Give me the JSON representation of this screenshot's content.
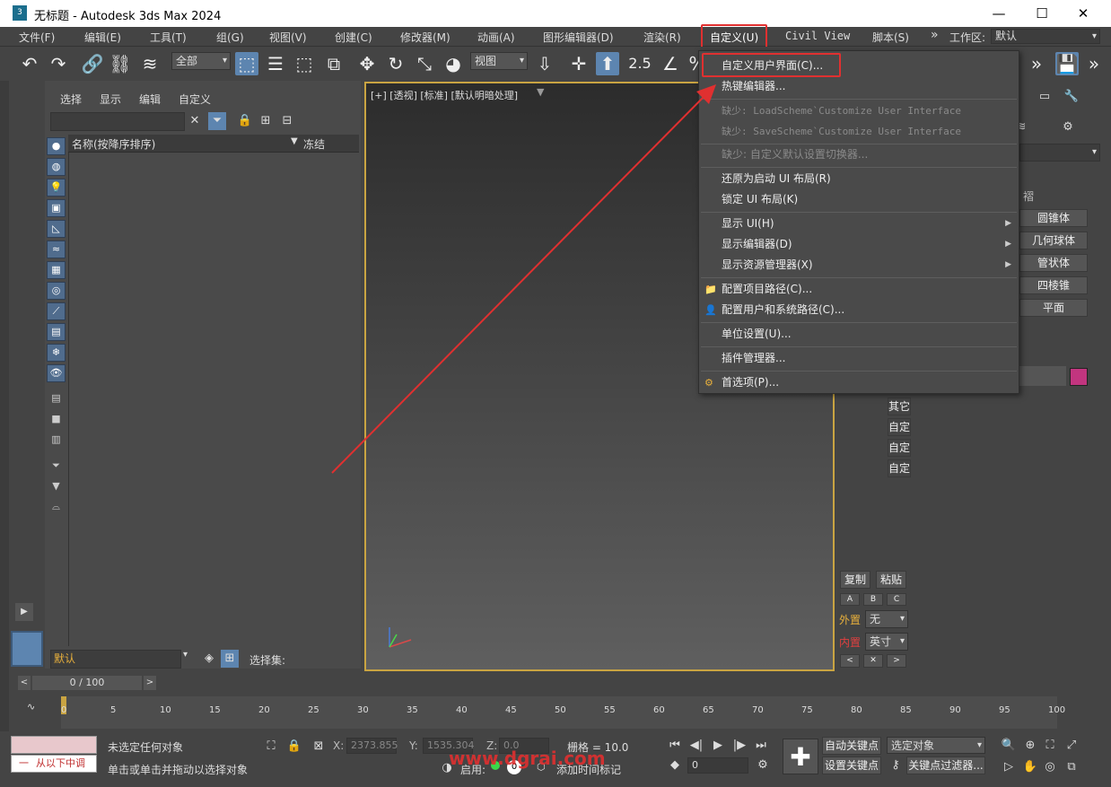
{
  "window": {
    "title": "无标题 - Autodesk 3ds Max 2024",
    "min": "—",
    "max": "☐",
    "close": "✕",
    "icon": "3"
  },
  "menubar": {
    "items": [
      "文件(F)",
      "编辑(E)",
      "工具(T)",
      "组(G)",
      "视图(V)",
      "创建(C)",
      "修改器(M)",
      "动画(A)",
      "图形编辑器(D)",
      "渲染(R)",
      "自定义(U)",
      "Civil View",
      "脚本(S)"
    ],
    "more": "»",
    "workspace_label": "工作区:",
    "workspace_value": "默认"
  },
  "toolbar": {
    "selection_filter": "全部",
    "ref_coord": "视图",
    "snap_label": "2.5"
  },
  "explorer": {
    "tabs": [
      "选择",
      "显示",
      "编辑",
      "自定义"
    ],
    "col_name": "名称(按降序排序)",
    "col_freeze": "冻结",
    "layer_value": "默认",
    "selection_set_label": "选择集:"
  },
  "viewport": {
    "label": "[+] [透视] [标准] [默认明暗处理]"
  },
  "custom_menu": {
    "items": [
      {
        "label": "自定义用户界面(C)...",
        "disabled": false
      },
      {
        "label": "热键编辑器...",
        "disabled": false
      },
      {
        "label": "缺少: LoadScheme`Customize User Interface",
        "disabled": true
      },
      {
        "label": "缺少: SaveScheme`Customize User Interface",
        "disabled": true
      },
      {
        "label": "缺少: 自定义默认设置切换器...",
        "disabled": true
      },
      {
        "label": "还原为启动 UI 布局(R)",
        "disabled": false
      },
      {
        "label": "锁定 UI 布局(K)",
        "disabled": false
      },
      {
        "label": "显示 UI(H)",
        "disabled": false
      },
      {
        "label": "显示编辑器(D)",
        "disabled": false
      },
      {
        "label": "显示资源管理器(X)",
        "disabled": false
      },
      {
        "label": "配置项目路径(C)...",
        "disabled": false
      },
      {
        "label": "配置用户和系统路径(C)...",
        "disabled": false
      },
      {
        "label": "单位设置(U)...",
        "disabled": false
      },
      {
        "label": "插件管理器...",
        "disabled": false
      },
      {
        "label": "首选项(P)...",
        "disabled": false
      }
    ]
  },
  "command_panel": {
    "partial_label": "褶",
    "buttons": [
      "圆锥体",
      "几何球体",
      "管状体",
      "四棱锥",
      "平面"
    ],
    "color": "#c2357f",
    "other_buttons": [
      "其它",
      "自定",
      "自定",
      "自定"
    ],
    "copy": "复制",
    "paste": "粘贴",
    "abc": [
      "A",
      "B",
      "C"
    ],
    "outer_label": "外置",
    "outer_value": "无",
    "inner_label": "内置",
    "inner_value": "英寸"
  },
  "timeline": {
    "frame_display": "0 / 100",
    "ticks": [
      "0",
      "5",
      "10",
      "15",
      "20",
      "25",
      "30",
      "35",
      "40",
      "45",
      "50",
      "55",
      "60",
      "65",
      "70",
      "75",
      "80",
      "85",
      "90",
      "95",
      "100"
    ]
  },
  "status": {
    "maxscript_text": "从以下中调",
    "selection_status": "未选定任何对象",
    "prompt": "单击或单击并拖动以选择对象",
    "x_label": "X:",
    "x_value": "2373.855",
    "y_label": "Y:",
    "y_value": "1535.304",
    "z_label": "Z:",
    "z_value": "0.0",
    "grid_label": "栅格 = 10.0",
    "enable_label": "启用:",
    "add_time_tag": "添加时间标记",
    "auto_key": "自动关键点",
    "set_key": "设置关键点",
    "key_target": "选定对象",
    "key_filter": "关键点过滤器...",
    "frame_value": "0",
    "watermark": "www.dgrai.com"
  }
}
